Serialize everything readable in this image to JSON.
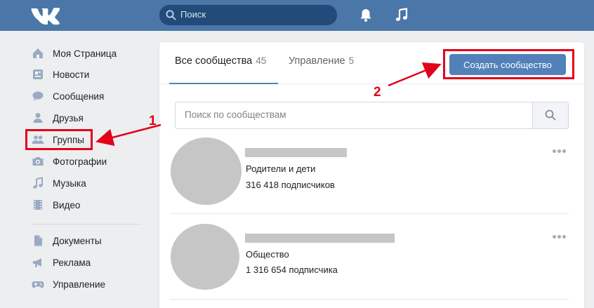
{
  "header": {
    "search_placeholder": "Поиск",
    "icons": [
      "vk-logo-icon",
      "search-icon",
      "bell-icon",
      "music-note-icon"
    ]
  },
  "sidebar": {
    "items": [
      {
        "label": "Моя Страница",
        "icon": "home-icon"
      },
      {
        "label": "Новости",
        "icon": "news-icon"
      },
      {
        "label": "Сообщения",
        "icon": "chat-icon"
      },
      {
        "label": "Друзья",
        "icon": "person-icon"
      },
      {
        "label": "Группы",
        "icon": "group-icon"
      },
      {
        "label": "Фотографии",
        "icon": "camera-icon"
      },
      {
        "label": "Музыка",
        "icon": "music-icon"
      },
      {
        "label": "Видео",
        "icon": "film-icon"
      },
      {
        "label": "Документы",
        "icon": "document-icon"
      },
      {
        "label": "Реклама",
        "icon": "megaphone-icon"
      },
      {
        "label": "Управление",
        "icon": "gamepad-icon"
      }
    ]
  },
  "tabs": [
    {
      "label": "Все сообщества",
      "count": "45"
    },
    {
      "label": "Управление",
      "count": "5"
    }
  ],
  "create_button_label": "Создать сообщество",
  "community_search_placeholder": "Поиск по сообществам",
  "groups": [
    {
      "category": "Родители и дети",
      "subscribers": "316 418 подписчиков"
    },
    {
      "category": "Общество",
      "subscribers": "1 316 654 подписчика"
    }
  ],
  "annotations": {
    "one": "1",
    "two": "2"
  },
  "colors": {
    "header": "#4a76a8",
    "accent": "#5181b8",
    "annotation": "#e2001a"
  }
}
